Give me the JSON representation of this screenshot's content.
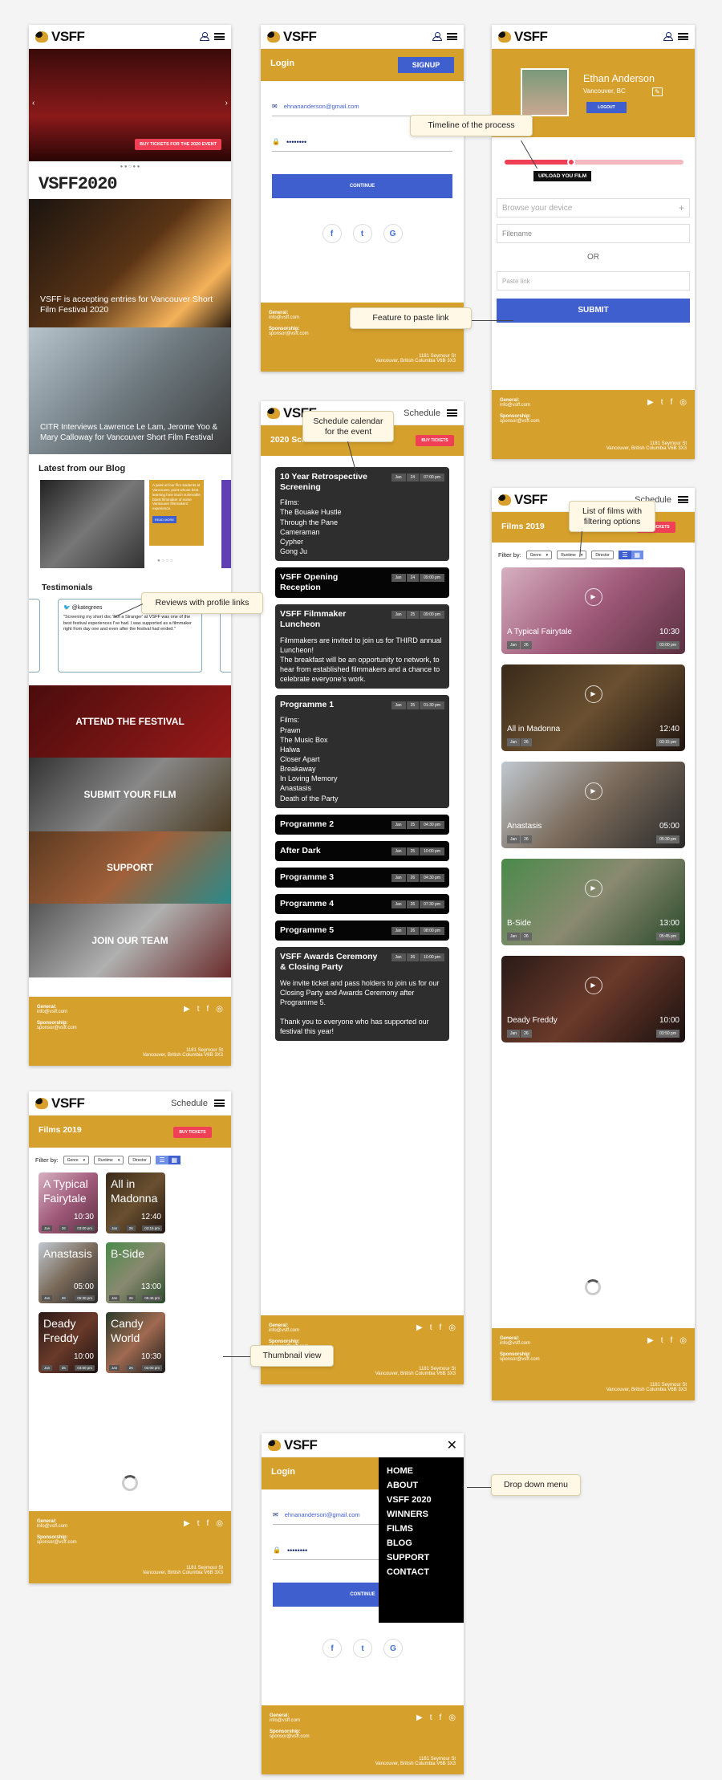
{
  "brand": "VSFF",
  "colors": {
    "gold": "#d6a02c",
    "blue": "#3f5fce",
    "red": "#ef4056"
  },
  "callouts": {
    "timeline": "Timeline of the process",
    "paste": "Feature to paste link",
    "reviews": "Reviews with profile links",
    "calendar": "Schedule calendar for the event",
    "filmlist": "List of films with filtering options",
    "thumbnail": "Thumbnail view",
    "dropdown": "Drop down menu"
  },
  "home": {
    "hero_button": "BUY TICKETS FOR THE 2020 EVENT",
    "year_logo": "VSFF2020",
    "news1": "VSFF is accepting entries for Vancouver Short Film Festival 2020",
    "news2": "CITR Interviews Lawrence Le Lam, Jerome Yoo & Mary Calloway for Vancouver Short Film Festival",
    "blog_title": "Latest from our Blog",
    "blog_text": "A peek at four film students at Vancouver, point whose best learning how much vulnerable blank filmmaker of some Vankouver filmmakers' experience.",
    "read_more": "READ MORE",
    "testimonials_title": "Testimonials",
    "tweet_handle": "@kategrees",
    "tweet_text": "\"Screening my short doc 'Not a Stranger' at VSFF was one of the best festival experiences I've had. I was supported as a filmmaker right from day one and even after the festival had ended.\"",
    "tiles": [
      "ATTEND THE FESTIVAL",
      "SUBMIT YOUR FILM",
      "SUPPORT",
      "JOIN OUR TEAM"
    ]
  },
  "footer": {
    "general_label": "General:",
    "general_email": "info@vsff.com",
    "sponsor_label": "Sponsorship:",
    "sponsor_email": "sponsor@vsff.com",
    "address1": "1181 Seymour St",
    "address2": "Vancouver, British Columbia V6B 3X3"
  },
  "login": {
    "title": "Login",
    "signup": "SIGNUP",
    "email": "ehnananderson@gmail.com",
    "password": "••••••••",
    "continue": "CONTINUE",
    "continue_short": "CONTINUE",
    "social": [
      "f",
      "t",
      "G"
    ]
  },
  "profile": {
    "name": "Ethan Anderson",
    "location": "Vancouver, BC",
    "logout": "LOGOUT",
    "upload_label": "UPLOAD YOU FILM",
    "browse_placeholder": "Browse your device",
    "filename_placeholder": "Filename",
    "or": "OR",
    "paste_placeholder": "Paste link",
    "submit": "SUBMIT"
  },
  "schedule": {
    "nav": "Schedule",
    "title": "2020 Schedule",
    "buy": "BUY TICKETS",
    "events": [
      {
        "title": "10 Year Retrospective Screening",
        "month": "Jan",
        "day": "24",
        "time": "07:00 pm",
        "label": "Films:",
        "body": "The Bouake Hustle\nThrough the Pane\nCameraman\nCypher\nGong Ju"
      },
      {
        "title": "VSFF Opening Reception",
        "month": "Jan",
        "day": "24",
        "time": "09:00 pm",
        "label": "",
        "body": ""
      },
      {
        "title": "VSFF Filmmaker Luncheon",
        "month": "Jan",
        "day": "25",
        "time": "09:00 pm",
        "label": "",
        "body": "Filmmakers are invited to join us for THIRD annual Luncheon!\nThe breakfast will be an opportunity to network, to hear from established filmmakers and a chance to celebrate everyone's work."
      },
      {
        "title": "Programme 1",
        "month": "Jan",
        "day": "25",
        "time": "01:30 pm",
        "label": "Films:",
        "body": "Prawn\nThe Music Box\nHalwa\nCloser Apart\nBreakaway\nIn Loving Memory\nAnastasis\nDeath of the Party"
      },
      {
        "title": "Programme 2",
        "month": "Jan",
        "day": "25",
        "time": "04:30 pm",
        "label": "",
        "body": ""
      },
      {
        "title": "After Dark",
        "month": "Jan",
        "day": "25",
        "time": "10:00 pm",
        "label": "",
        "body": ""
      },
      {
        "title": "Programme 3",
        "month": "Jan",
        "day": "26",
        "time": "04:30 pm",
        "label": "",
        "body": ""
      },
      {
        "title": "Programme 4",
        "month": "Jan",
        "day": "26",
        "time": "07:30 pm",
        "label": "",
        "body": ""
      },
      {
        "title": "Programme 5",
        "month": "Jan",
        "day": "26",
        "time": "08:00 pm",
        "label": "",
        "body": ""
      },
      {
        "title": "VSFF Awards Ceremony & Closing Party",
        "month": "Jan",
        "day": "26",
        "time": "10:00 pm",
        "label": "",
        "body": "We invite ticket and pass holders to join us for our Closing Party and Awards Ceremony after Programme 5.\n\nThank you to everyone who has supported our festival this year!"
      }
    ]
  },
  "films": {
    "title": "Films 2019",
    "buy": "BUY TICKETS",
    "filter_label": "Filter by:",
    "filters": [
      "Genre",
      "Runtime",
      "Director"
    ],
    "list": [
      {
        "name": "A Typical Fairytale",
        "dur": "10:30",
        "month": "Jan",
        "day": "26",
        "time": "03:00 pm"
      },
      {
        "name": "All in Madonna",
        "dur": "12:40",
        "month": "Jan",
        "day": "26",
        "time": "03:15 pm"
      },
      {
        "name": "Anastasis",
        "dur": "05:00",
        "month": "Jan",
        "day": "26",
        "time": "05:30 pm"
      },
      {
        "name": "B-Side",
        "dur": "13:00",
        "month": "Jan",
        "day": "26",
        "time": "05:45 pm"
      },
      {
        "name": "Deady Freddy",
        "dur": "10:00",
        "month": "Jan",
        "day": "26",
        "time": "03:50 pm"
      },
      {
        "name": "Candy World",
        "dur": "10:30",
        "month": "Jan",
        "day": "26",
        "time": "03:00 pm"
      }
    ]
  },
  "menu": {
    "items": [
      "HOME",
      "ABOUT",
      "VSFF 2020",
      "WINNERS",
      "FILMS",
      "BLOG",
      "SUPPORT",
      "CONTACT"
    ]
  }
}
